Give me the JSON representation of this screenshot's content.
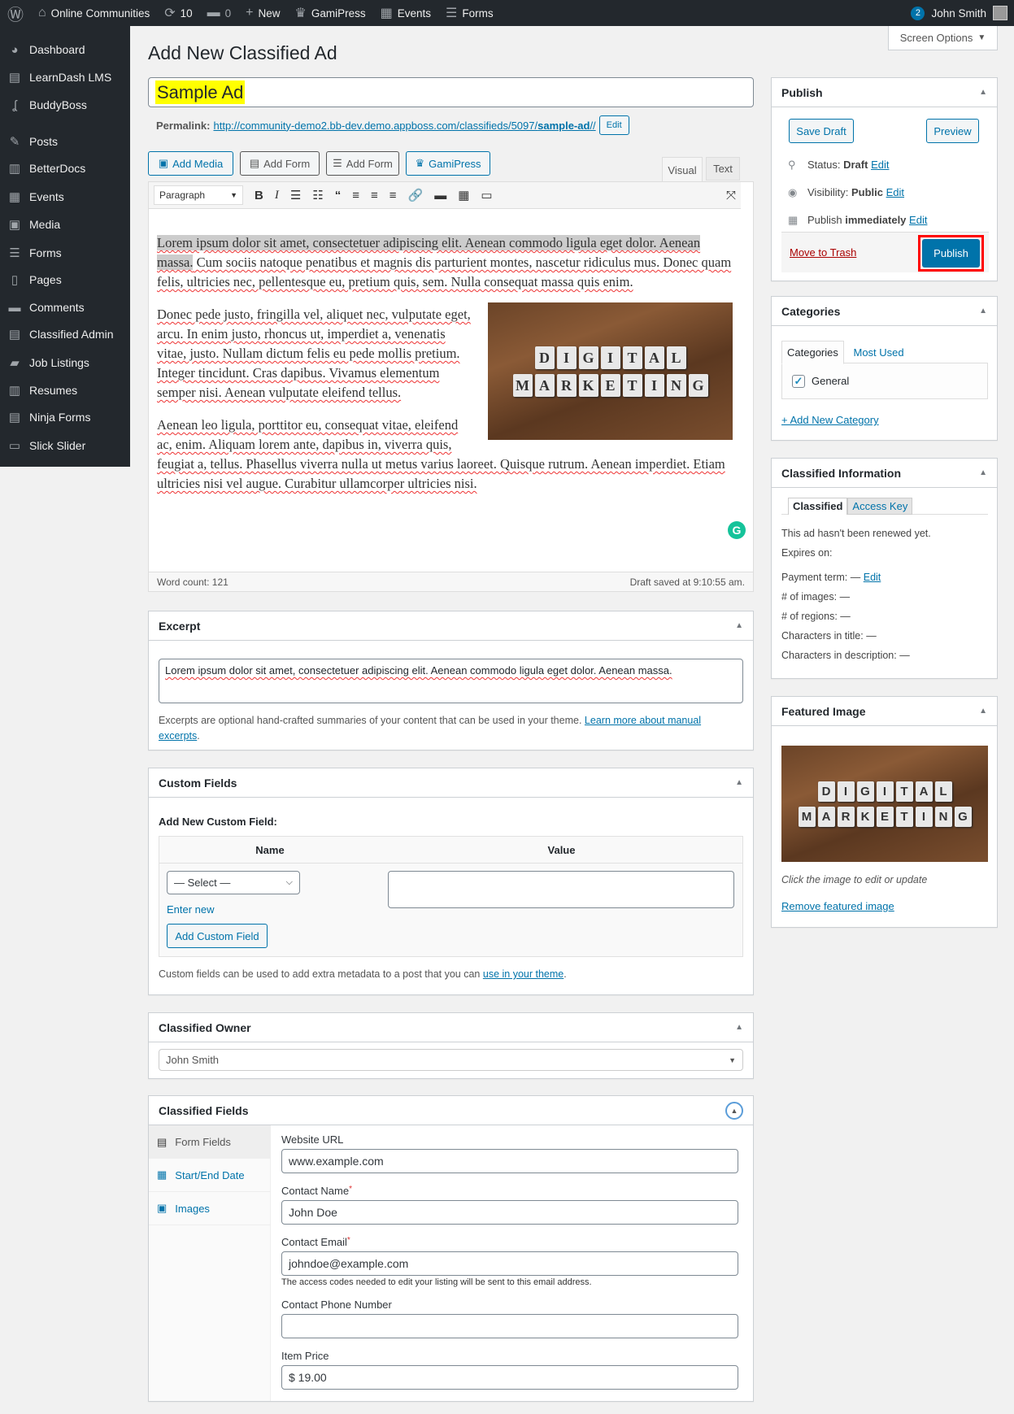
{
  "topbar": {
    "site": "Online Communities",
    "updates": "10",
    "comments": "0",
    "new": "New",
    "gamipress": "GamiPress",
    "events": "Events",
    "forms": "Forms",
    "notif": "2",
    "user": "John Smith"
  },
  "sidebar": {
    "items": [
      {
        "label": "Dashboard",
        "icon": "dashboard-icon"
      },
      {
        "label": "LearnDash LMS",
        "icon": "learndash-icon"
      },
      {
        "label": "BuddyBoss",
        "icon": "buddyboss-icon"
      },
      {
        "label": "Posts",
        "icon": "pin-icon"
      },
      {
        "label": "BetterDocs",
        "icon": "docs-icon"
      },
      {
        "label": "Events",
        "icon": "calendar-icon"
      },
      {
        "label": "Media",
        "icon": "media-icon"
      },
      {
        "label": "Forms",
        "icon": "forms-icon"
      },
      {
        "label": "Pages",
        "icon": "pages-icon"
      },
      {
        "label": "Comments",
        "icon": "comment-icon"
      },
      {
        "label": "Classified Admin",
        "icon": "list-icon"
      },
      {
        "label": "Job Listings",
        "icon": "briefcase-icon"
      },
      {
        "label": "Resumes",
        "icon": "document-icon"
      },
      {
        "label": "Ninja Forms",
        "icon": "list-icon"
      },
      {
        "label": "Slick Slider",
        "icon": "slider-icon"
      }
    ]
  },
  "screen_options": "Screen Options",
  "page_title": "Add New Classified Ad",
  "post_title": "Sample Ad",
  "permalink": {
    "label": "Permalink:",
    "url_base": "http://community-demo2.bb-dev.demo.appboss.com/classifieds/5097/",
    "slug": "sample-ad",
    "url_end": "//",
    "edit": "Edit"
  },
  "media_buttons": [
    "Add Media",
    "Add Form",
    "Add Form",
    "GamiPress"
  ],
  "editor_tabs": {
    "visual": "Visual",
    "text": "Text"
  },
  "toolbar": {
    "format": "Paragraph"
  },
  "content": {
    "p1_sel": "Lorem ipsum dolor sit amet, consectetuer adipiscing elit. Aenean commodo ligula eget dolor. Aenean massa.",
    "p1_rest": " Cum sociis natoque penatibus et magnis dis parturient montes, nascetur ridiculus mus. Donec quam felis, ultricies nec, pellentesque eu, pretium quis, sem. Nulla consequat massa quis enim.",
    "p2": "Donec pede justo, fringilla vel, aliquet nec, vulputate eget, arcu. In enim justo, rhoncus ut, imperdiet a, venenatis vitae, justo. Nullam dictum felis eu pede mollis pretium. Integer tincidunt. Cras dapibus. Vivamus elementum semper nisi. Aenean vulputate eleifend tellus.",
    "p3": "Aenean leo ligula, porttitor eu, consequat vitae, eleifend ac, enim. Aliquam lorem ante, dapibus in, viverra quis, feugiat a, tellus. Phasellus viverra nulla ut metus varius laoreet. Quisque rutrum. Aenean imperdiet. Etiam ultricies nisi vel augue. Curabitur ullamcorper ultricies nisi.",
    "image_text": [
      "DIGITAL",
      "MARKETING"
    ]
  },
  "status_bar": {
    "word_count": "Word count: 121",
    "draft_saved": "Draft saved at 9:10:55 am."
  },
  "excerpt": {
    "title": "Excerpt",
    "value": "Lorem ipsum dolor sit amet, consectetuer adipiscing elit. Aenean commodo ligula eget dolor. Aenean massa.",
    "help": "Excerpts are optional hand-crafted summaries of your content that can be used in your theme.",
    "link": "Learn more about manual excerpts"
  },
  "custom_fields": {
    "title": "Custom Fields",
    "add_new": "Add New Custom Field:",
    "col_name": "Name",
    "col_value": "Value",
    "select": "— Select —",
    "enter_new": "Enter new",
    "add_button": "Add Custom Field",
    "help": "Custom fields can be used to add extra metadata to a post that you can",
    "help_link": "use in your theme"
  },
  "owner": {
    "title": "Classified Owner",
    "value": "John Smith"
  },
  "classified_fields": {
    "title": "Classified Fields",
    "tabs": [
      "Form Fields",
      "Start/End Date",
      "Images"
    ],
    "fields": [
      {
        "label": "Website URL",
        "value": "www.example.com",
        "required": false
      },
      {
        "label": "Contact Name",
        "value": "John Doe",
        "required": true
      },
      {
        "label": "Contact Email",
        "value": "johndoe@example.com",
        "required": true,
        "help": "The access codes needed to edit your listing will be sent to this email address."
      },
      {
        "label": "Contact Phone Number",
        "value": "",
        "required": false
      },
      {
        "label": "Item Price",
        "value": "$  19.00",
        "required": false
      }
    ]
  },
  "publish": {
    "title": "Publish",
    "save_draft": "Save Draft",
    "preview": "Preview",
    "status_label": "Status:",
    "status": "Draft",
    "visibility_label": "Visibility:",
    "visibility": "Public",
    "publish_label": "Publish",
    "publish_when": "immediately",
    "edit": "Edit",
    "trash": "Move to Trash",
    "publish_button": "Publish"
  },
  "categories": {
    "title": "Categories",
    "tab_all": "Categories",
    "tab_used": "Most Used",
    "items": [
      {
        "label": "General",
        "checked": true
      }
    ],
    "add_new": "+ Add New Category"
  },
  "classified_info": {
    "title": "Classified Information",
    "tab1": "Classified",
    "tab2": "Access Key",
    "renewed": "This ad hasn't been renewed yet.",
    "expires": "Expires on:",
    "payment_term": "Payment term: —",
    "edit": "Edit",
    "images": "# of images: —",
    "regions": "# of regions: —",
    "chars_title": "Characters in title: —",
    "chars_desc": "Characters in description: —"
  },
  "featured_image": {
    "title": "Featured Image",
    "hint": "Click the image to edit or update",
    "remove": "Remove featured image"
  },
  "colors": {
    "accent": "#0073aa",
    "admin_bar": "#23282d",
    "highlight": "#ffff00",
    "publish_outline": "#ff0000"
  }
}
